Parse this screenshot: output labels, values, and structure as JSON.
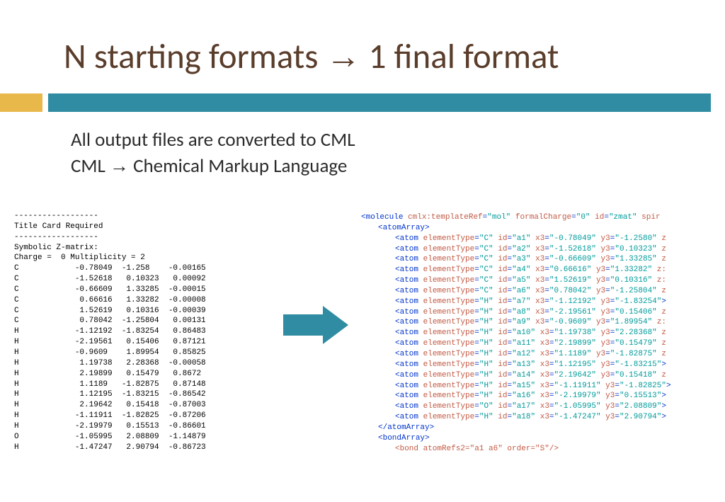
{
  "title": {
    "left": "N starting formats",
    "arrow": "→",
    "right": "1 final format"
  },
  "bullets": {
    "line1": "All output files are converted to CML",
    "line2_left": "CML",
    "line2_arrow": "→",
    "line2_right": "Chemical Markup Language"
  },
  "zmatrix": "------------------\nTitle Card Required\n------------------\nSymbolic Z-matrix:\nCharge =  0 Multiplicity = 2\nC            -0.78049  -1.258    -0.00165\nC            -1.52618   0.10323   0.00092\nC            -0.66609   1.33285  -0.00015\nC             0.66616   1.33282  -0.00008\nC             1.52619   0.10316  -0.00039\nC             0.78042  -1.25804   0.00131\nH            -1.12192  -1.83254   0.86483\nH            -2.19561   0.15406   0.87121\nH            -0.9609    1.89954   0.85825\nH             1.19738   2.28368  -0.00058\nH             2.19899   0.15479   0.8672\nH             1.1189   -1.82875   0.87148\nH             1.12195  -1.83215  -0.86542\nH             2.19642   0.15418  -0.87003\nH            -1.11911  -1.82825  -0.87206\nH            -2.19979   0.15513  -0.86601\nO            -1.05995   2.08809  -1.14879\nH            -1.47247   2.90794  -0.86723",
  "cml": {
    "mol_open": {
      "tag": "molecule",
      "attrs": [
        [
          "cmlx:templateRef",
          "mol"
        ],
        [
          "formalCharge",
          "0"
        ],
        [
          "id",
          "zmat"
        ]
      ],
      "tail": "spir"
    },
    "atomArray_open": "atomArray",
    "atoms": [
      {
        "elementType": "C",
        "id": "a1",
        "x3": "-0.78049",
        "y3": "-1.2580",
        "tail": "z"
      },
      {
        "elementType": "C",
        "id": "a2",
        "x3": "-1.52618",
        "y3": "0.10323",
        "tail": "z"
      },
      {
        "elementType": "C",
        "id": "a3",
        "x3": "-0.66609",
        "y3": "1.33285",
        "tail": "z"
      },
      {
        "elementType": "C",
        "id": "a4",
        "x3": "0.66616",
        "y3": "1.33282",
        "tail": "z:"
      },
      {
        "elementType": "C",
        "id": "a5",
        "x3": "1.52619",
        "y3": "0.10316",
        "tail": "z:"
      },
      {
        "elementType": "C",
        "id": "a6",
        "x3": "0.78042",
        "y3": "-1.25804",
        "tail": "z"
      },
      {
        "elementType": "H",
        "id": "a7",
        "x3": "-1.12192",
        "y3": "-1.83254",
        "tail": ""
      },
      {
        "elementType": "H",
        "id": "a8",
        "x3": "-2.19561",
        "y3": "0.15406",
        "tail": "z"
      },
      {
        "elementType": "H",
        "id": "a9",
        "x3": "-0.9609",
        "y3": "1.89954",
        "tail": "z:"
      },
      {
        "elementType": "H",
        "id": "a10",
        "x3": "1.19738",
        "y3": "2.28368",
        "tail": "z"
      },
      {
        "elementType": "H",
        "id": "a11",
        "x3": "2.19899",
        "y3": "0.15479",
        "tail": "z"
      },
      {
        "elementType": "H",
        "id": "a12",
        "x3": "1.1189",
        "y3": "-1.82875",
        "tail": "z"
      },
      {
        "elementType": "H",
        "id": "a13",
        "x3": "1.12195",
        "y3": "-1.83215",
        "tail": ""
      },
      {
        "elementType": "H",
        "id": "a14",
        "x3": "2.19642",
        "y3": "0.15418",
        "tail": "z"
      },
      {
        "elementType": "H",
        "id": "a15",
        "x3": "-1.11911",
        "y3": "-1.82825",
        "tail": ""
      },
      {
        "elementType": "H",
        "id": "a16",
        "x3": "-2.19979",
        "y3": "0.15513",
        "tail": ""
      },
      {
        "elementType": "O",
        "id": "a17",
        "x3": "-1.05995",
        "y3": "2.08809",
        "tail": ""
      },
      {
        "elementType": "H",
        "id": "a18",
        "x3": "-1.47247",
        "y3": "2.90794",
        "tail": ""
      }
    ],
    "atomArray_close": "atomArray",
    "bondArray_open": "bondArray",
    "bond_tail": "<bond atomRefs2=\"a1 a6\" order=\"S\"/>"
  }
}
